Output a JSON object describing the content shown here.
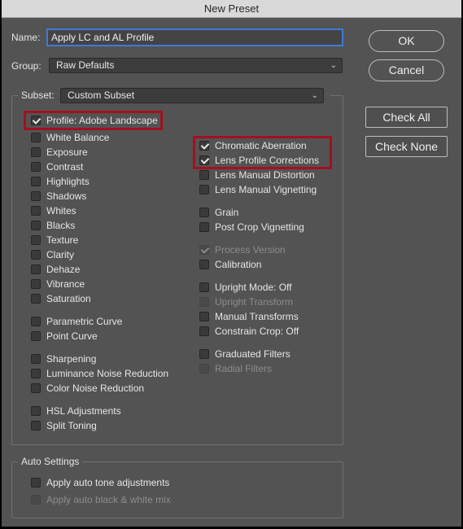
{
  "window": {
    "title": "New Preset"
  },
  "name": {
    "label": "Name:",
    "value": "Apply LC and AL Profile"
  },
  "group": {
    "label": "Group:",
    "value": "Raw Defaults"
  },
  "subset": {
    "label": "Subset:",
    "value": "Custom Subset"
  },
  "buttons": {
    "ok": "OK",
    "cancel": "Cancel",
    "check_all": "Check All",
    "check_none": "Check None"
  },
  "left_items": [
    {
      "label": "Profile: Adobe Landscape",
      "checked": true,
      "disabled": false
    },
    {
      "label": "White Balance",
      "checked": false,
      "disabled": false
    },
    {
      "label": "Exposure",
      "checked": false,
      "disabled": false
    },
    {
      "label": "Contrast",
      "checked": false,
      "disabled": false
    },
    {
      "label": "Highlights",
      "checked": false,
      "disabled": false
    },
    {
      "label": "Shadows",
      "checked": false,
      "disabled": false
    },
    {
      "label": "Whites",
      "checked": false,
      "disabled": false
    },
    {
      "label": "Blacks",
      "checked": false,
      "disabled": false
    },
    {
      "label": "Texture",
      "checked": false,
      "disabled": false
    },
    {
      "label": "Clarity",
      "checked": false,
      "disabled": false
    },
    {
      "label": "Dehaze",
      "checked": false,
      "disabled": false
    },
    {
      "label": "Vibrance",
      "checked": false,
      "disabled": false
    },
    {
      "label": "Saturation",
      "checked": false,
      "disabled": false
    },
    {
      "label": "Parametric Curve",
      "checked": false,
      "disabled": false
    },
    {
      "label": "Point Curve",
      "checked": false,
      "disabled": false
    },
    {
      "label": "Sharpening",
      "checked": false,
      "disabled": false
    },
    {
      "label": "Luminance Noise Reduction",
      "checked": false,
      "disabled": false
    },
    {
      "label": "Color Noise Reduction",
      "checked": false,
      "disabled": false
    },
    {
      "label": "HSL Adjustments",
      "checked": false,
      "disabled": false
    },
    {
      "label": "Split Toning",
      "checked": false,
      "disabled": false
    }
  ],
  "right_items": [
    {
      "label": "Chromatic Aberration",
      "checked": true,
      "disabled": false
    },
    {
      "label": "Lens Profile Corrections",
      "checked": true,
      "disabled": false
    },
    {
      "label": "Lens Manual Distortion",
      "checked": false,
      "disabled": false
    },
    {
      "label": "Lens Manual Vignetting",
      "checked": false,
      "disabled": false
    },
    {
      "label": "Grain",
      "checked": false,
      "disabled": false
    },
    {
      "label": "Post Crop Vignetting",
      "checked": false,
      "disabled": false
    },
    {
      "label": "Process Version",
      "checked": true,
      "disabled": true
    },
    {
      "label": "Calibration",
      "checked": false,
      "disabled": false
    },
    {
      "label": "Upright Mode: Off",
      "checked": false,
      "disabled": false
    },
    {
      "label": "Upright Transform",
      "checked": false,
      "disabled": true
    },
    {
      "label": "Manual Transforms",
      "checked": false,
      "disabled": false
    },
    {
      "label": "Constrain Crop: Off",
      "checked": false,
      "disabled": false
    },
    {
      "label": "Graduated Filters",
      "checked": false,
      "disabled": false
    },
    {
      "label": "Radial Filters",
      "checked": false,
      "disabled": true
    }
  ],
  "auto_settings": {
    "title": "Auto Settings",
    "items": [
      {
        "label": "Apply auto tone adjustments",
        "checked": false,
        "disabled": false
      },
      {
        "label": "Apply auto black & white mix",
        "checked": false,
        "disabled": true
      }
    ]
  },
  "colors": {
    "highlight": "#a3101f",
    "focus": "#3d7bd8",
    "background": "#535353"
  }
}
